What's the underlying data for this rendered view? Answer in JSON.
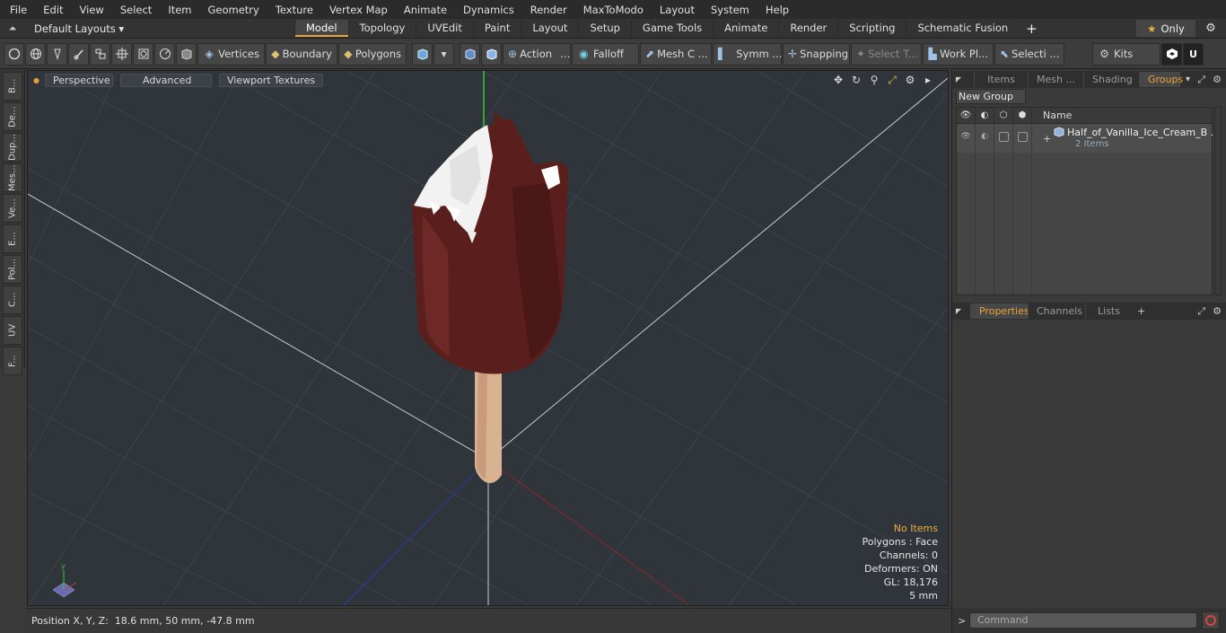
{
  "menubar": {
    "items": [
      "File",
      "Edit",
      "View",
      "Select",
      "Item",
      "Geometry",
      "Texture",
      "Vertex Map",
      "Animate",
      "Dynamics",
      "Render",
      "MaxToModo",
      "Layout",
      "System",
      "Help"
    ]
  },
  "layoutbar": {
    "layout_selector": "Default Layouts",
    "tabs": [
      "Model",
      "Topology",
      "UVEdit",
      "Paint",
      "Layout",
      "Setup",
      "Game Tools",
      "Animate",
      "Render",
      "Scripting",
      "Schematic Fusion"
    ],
    "active_tab": "Model",
    "only_label": "Only"
  },
  "toolbar": {
    "vertices": "Vertices",
    "boundary": "Boundary",
    "polygons": "Polygons",
    "action": "Action",
    "falloff": "Falloff",
    "mesh_c": "Mesh C ...",
    "symm": "Symm ...",
    "snapping": "Snapping",
    "select_t": "Select T...",
    "work_pl": "Work Pl...",
    "selecti": "Selecti ...",
    "kits": "Kits"
  },
  "leftstrip": {
    "tabs": [
      "B...",
      "De...",
      "Dup...",
      "Mes...",
      "Ve...",
      "E...",
      "Pol...",
      "C...",
      "UV",
      "F..."
    ]
  },
  "viewport": {
    "perspective": "Perspective",
    "advanced": "Advanced",
    "viewport_textures": "Viewport Textures",
    "info": {
      "no_items": "No Items",
      "polygons": "Polygons : Face",
      "channels": "Channels: 0",
      "deformers": "Deformers: ON",
      "gl": "GL: 18,176",
      "scale": "5 mm"
    }
  },
  "statusbar": {
    "position_label": "Position X, Y, Z:",
    "position_value": "18.6 mm, 50 mm, -47.8 mm"
  },
  "rightpanel": {
    "top_tabs": [
      "Items",
      "Mesh ...",
      "Shading",
      "Groups"
    ],
    "active_top_tab": "Groups",
    "new_group": "New Group",
    "name_header": "Name",
    "group": {
      "name": "Half_of_Vanilla_Ice_Cream_B ...",
      "count": "2 Items"
    },
    "bottom_tabs": [
      "Properties",
      "Channels",
      "Lists"
    ],
    "active_bottom_tab": "Properties",
    "command_placeholder": "Command"
  },
  "colors": {
    "accent": "#e8a43a",
    "viewport_bg": "#2f353a",
    "chocolate": "#5a1e1c",
    "stick": "#d9b291"
  }
}
